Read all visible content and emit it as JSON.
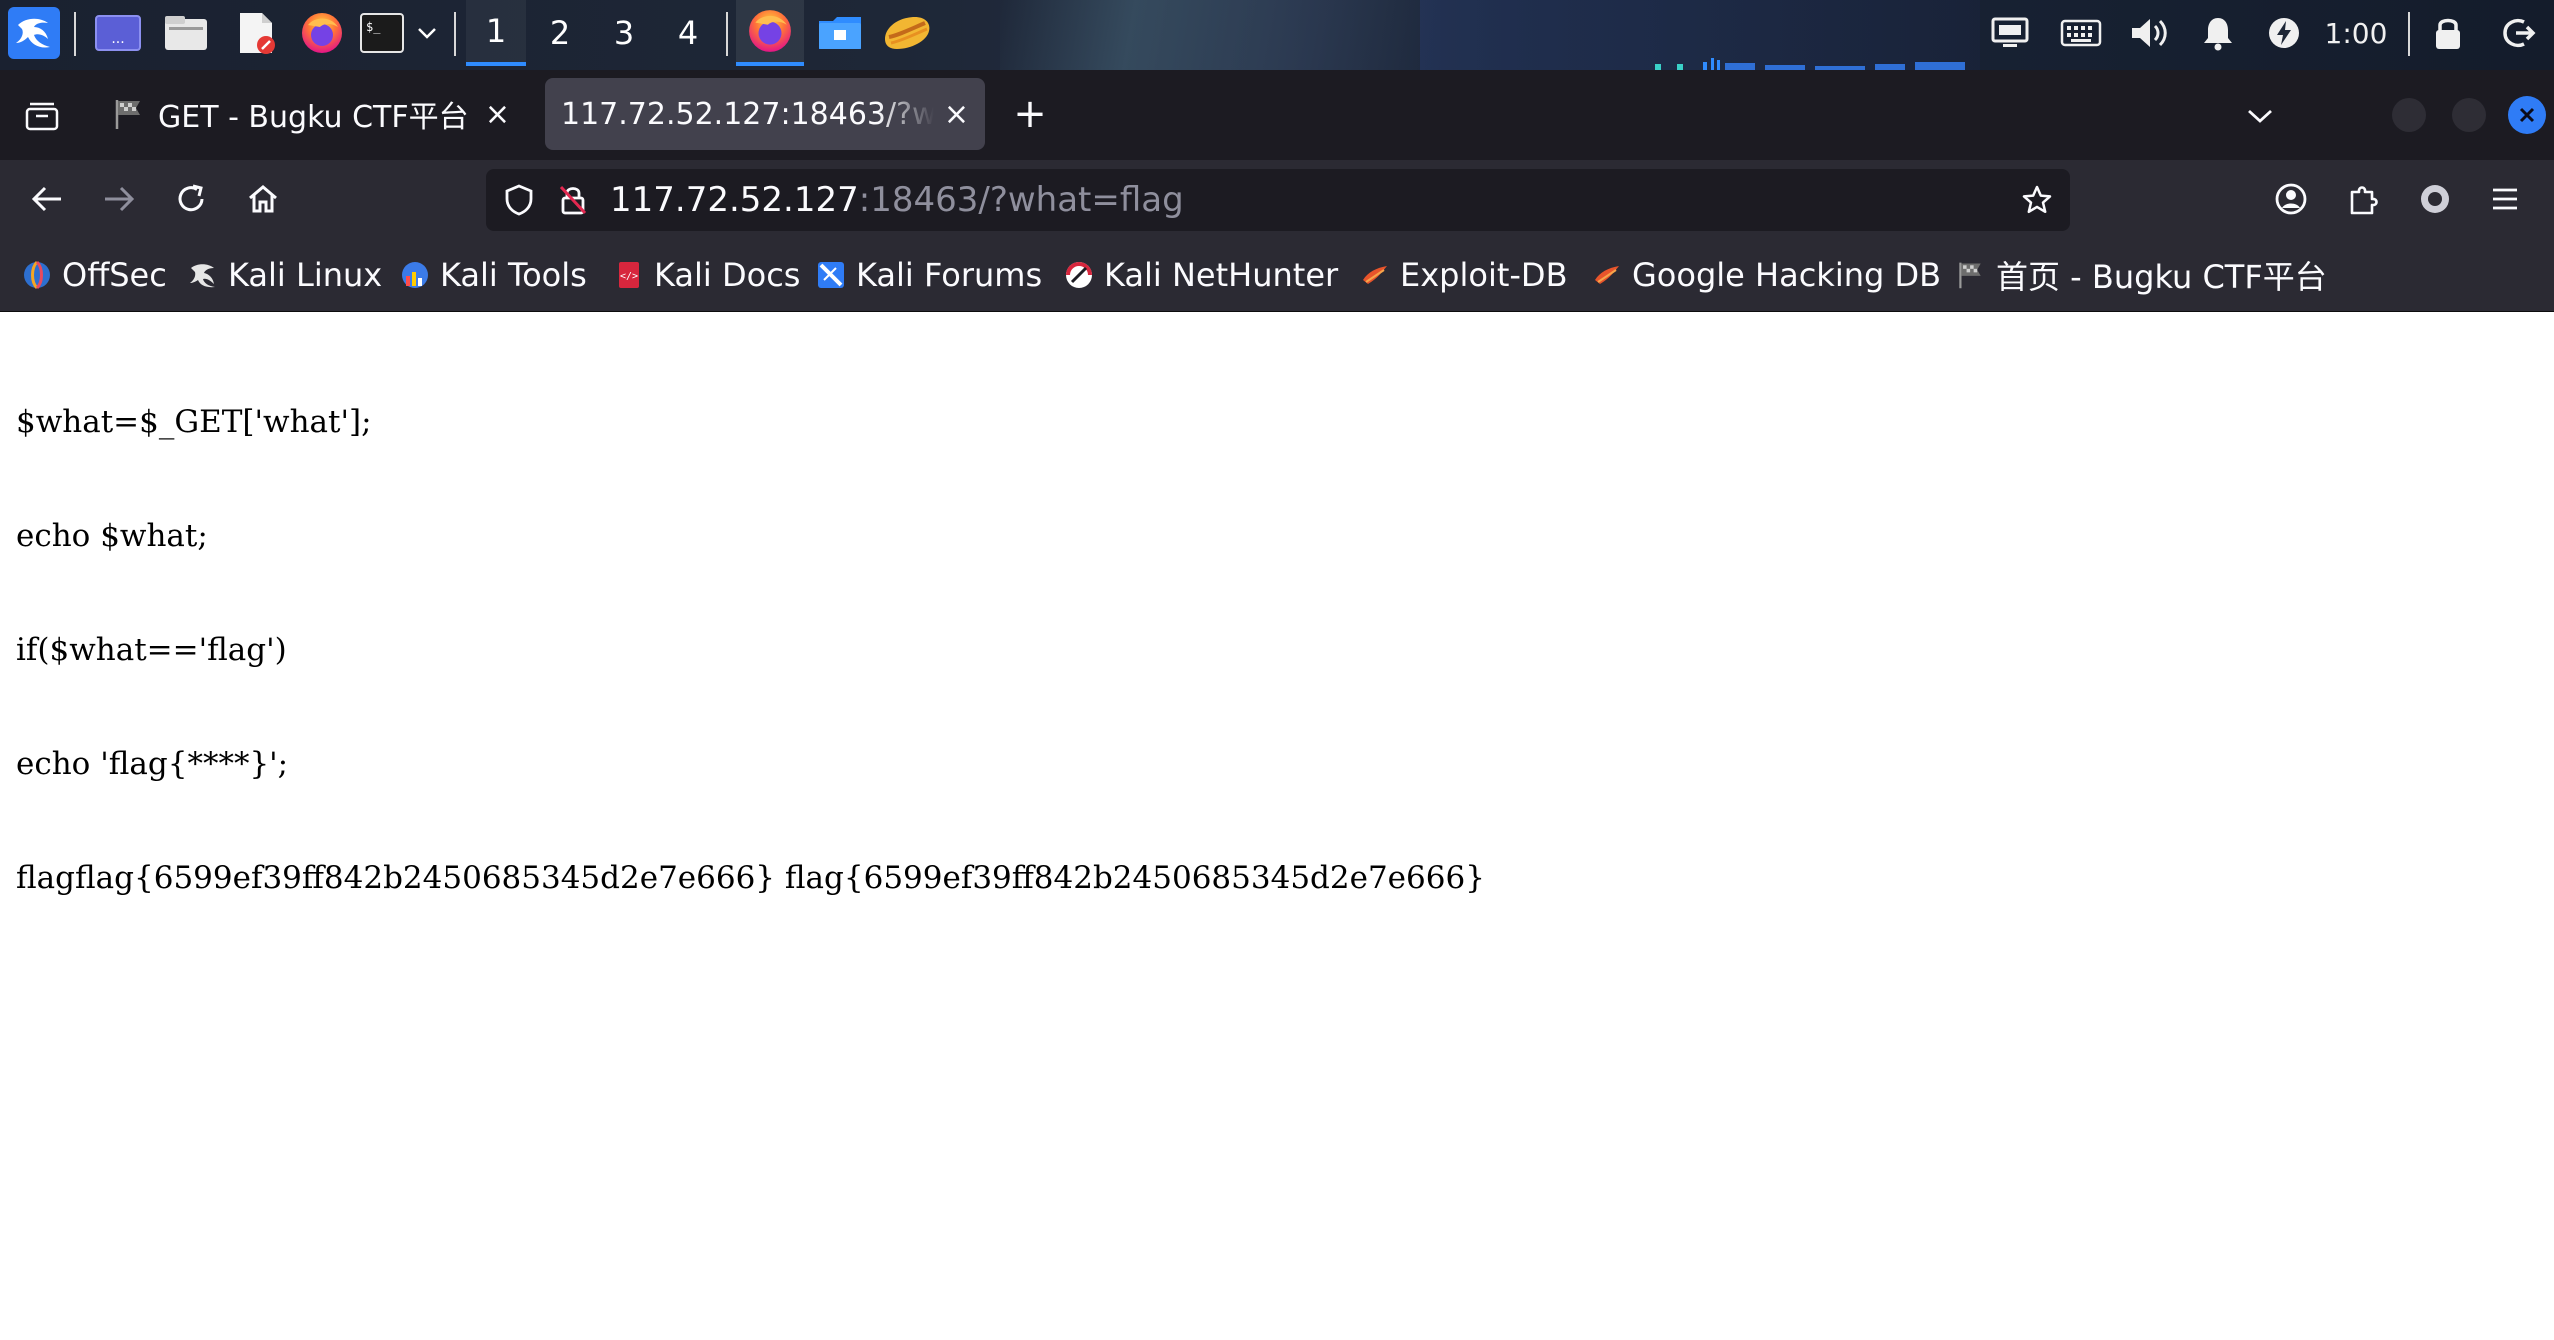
{
  "taskbar": {
    "workspaces": [
      "1",
      "2",
      "3",
      "4"
    ],
    "active_workspace": "1",
    "clock": "1:00",
    "icons": {
      "menu": "kali-dragon-icon",
      "show_desktop": "desktop-icon",
      "file_manager": "file-manager-icon",
      "text_editor": "text-editor-icon",
      "browser": "firefox-icon",
      "terminal": "terminal-icon",
      "terminal_menu": "chevron-down-icon",
      "running_firefox": "firefox-icon",
      "running_files": "folder-icon",
      "running_app": "burp-icon",
      "display": "display-icon",
      "keyboard": "keyboard-icon",
      "volume": "volume-icon",
      "notifications": "bell-icon",
      "power_manager": "power-icon",
      "lock": "lock-icon",
      "logout": "logout-icon"
    },
    "accent_color": "#2f8cff"
  },
  "browser": {
    "tabs": [
      {
        "label": "GET - Bugku CTF平台",
        "selected": false
      },
      {
        "label": "117.72.52.127:18463/?what=flag",
        "selected": true
      }
    ],
    "new_tab_label": "+",
    "close_glyph": "×",
    "url": {
      "host": "117.72.52.127",
      "rest": ":18463/?what=flag"
    },
    "bookmarks": [
      {
        "label": "OffSec",
        "icon": "offsec-icon"
      },
      {
        "label": "Kali Linux",
        "icon": "kali-icon"
      },
      {
        "label": "Kali Tools",
        "icon": "kali-tools-icon"
      },
      {
        "label": "Kali Docs",
        "icon": "kali-docs-icon"
      },
      {
        "label": "Kali Forums",
        "icon": "kali-forums-icon"
      },
      {
        "label": "Kali NetHunter",
        "icon": "nethunter-icon"
      },
      {
        "label": "Exploit-DB",
        "icon": "exploit-db-icon"
      },
      {
        "label": "Google Hacking DB",
        "icon": "ghdb-icon"
      },
      {
        "label": "首页 - Bugku CTF平台",
        "icon": "bugku-flag-icon"
      }
    ],
    "theme": {
      "tabstrip": "#1c1b22",
      "toolbar": "#2b2a33",
      "selected_tab": "#42414d",
      "text": "#fbfbfe"
    }
  },
  "page": {
    "lines": [
      "$what=$_GET['what'];",
      "echo $what;",
      "if($what=='flag')",
      "echo 'flag{****}';",
      "flagflag{6599ef39ff842b2450685345d2e7e666} flag{6599ef39ff842b2450685345d2e7e666}"
    ]
  }
}
